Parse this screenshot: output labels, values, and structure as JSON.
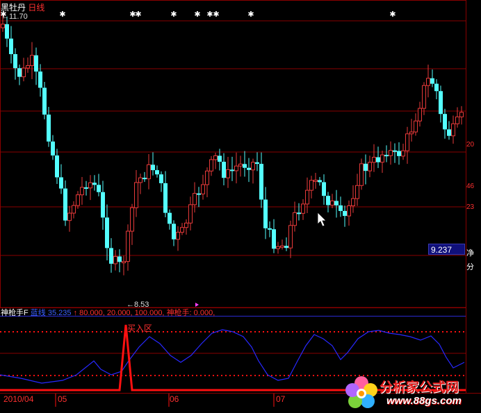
{
  "window": {
    "stock_name": "黑牡丹",
    "period": "日线"
  },
  "price_panel": {
    "high_label": "←11.70",
    "low_label": "←8.53",
    "current_price": "9.237",
    "right_labels": [
      "20",
      "46",
      "23",
      "净",
      "分"
    ]
  },
  "indicator_panel": {
    "name": "神枪手F",
    "line_name": "蓝线",
    "line_value": "35.235",
    "arrow_value": "↑ 80.000,",
    "value_20": "20.000,",
    "value_100": "100.000,",
    "shooter_label": "神枪手: 0.000,",
    "buy_zone": "买入区"
  },
  "time_axis": {
    "labels": [
      "2010/04",
      "05",
      "06",
      "07"
    ]
  },
  "watermark": {
    "site_name": "分析家公式网",
    "url": "www.88gs.com"
  },
  "colors": {
    "background": "#000000",
    "up_candle": "#e83a3a",
    "down_candle": "#54ffff",
    "grid": "#8a0000",
    "indicator_line": "#2828ff",
    "signal": "#ff1010",
    "label_white": "#ffffff",
    "label_blue": "#3a60ff"
  }
}
